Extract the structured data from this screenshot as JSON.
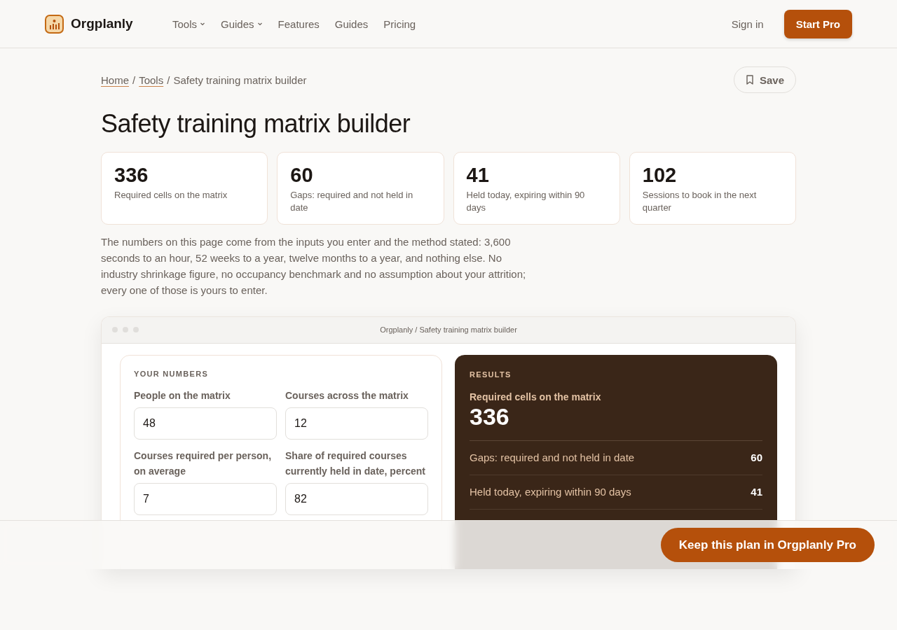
{
  "brand": {
    "name": "Orgplanly"
  },
  "nav": [
    {
      "label": "Tools",
      "dropdown": true
    },
    {
      "label": "Guides",
      "dropdown": true
    },
    {
      "label": "Features",
      "dropdown": false
    },
    {
      "label": "Guides",
      "dropdown": false
    },
    {
      "label": "Pricing",
      "dropdown": false
    }
  ],
  "header_actions": {
    "sign_in": "Sign in",
    "start": "Start Pro"
  },
  "breadcrumb": [
    {
      "label": "Home",
      "link": true
    },
    {
      "separator": "/",
      "label": "Tools",
      "link": true
    },
    {
      "separator": "/",
      "label": "Safety training matrix builder",
      "link": false
    }
  ],
  "save_button": "Save",
  "title": "Safety training matrix builder",
  "stats": [
    {
      "value": "336",
      "label": "Required cells on the matrix"
    },
    {
      "value": "60",
      "label": "Gaps: required and not held in date"
    },
    {
      "value": "41",
      "label": "Held today, expiring within 90 days"
    },
    {
      "value": "102",
      "label": "Sessions to book in the next quarter"
    }
  ],
  "intro": "The numbers on this page come from the inputs you enter and the method stated: 3,600 seconds to an hour, 52 weeks to a year, twelve months to a year, and nothing else. No industry shrinkage figure, no occupancy benchmark and no assumption about your attrition; every one of those is yours to enter.",
  "app_window": {
    "title": "Orgplanly / Safety training matrix builder",
    "inputs": {
      "heading": "YOUR NUMBERS",
      "fields": [
        {
          "label": "People on the matrix",
          "value": "48"
        },
        {
          "label": "Courses across the matrix",
          "value": "12"
        },
        {
          "label": "Courses required per person, on average",
          "value": "7"
        },
        {
          "label": "Share of required courses currently held in date, percent",
          "value": "82"
        }
      ]
    },
    "results": {
      "heading": "RESULTS",
      "main_label": "Required cells on the matrix",
      "main_value": "336",
      "rows": [
        {
          "label": "Gaps: required and not held in date",
          "value": "60"
        },
        {
          "label": "Held today, expiring within 90 days",
          "value": "41"
        }
      ]
    }
  },
  "sticky_cta": "Keep this plan in Orgplanly Pro"
}
